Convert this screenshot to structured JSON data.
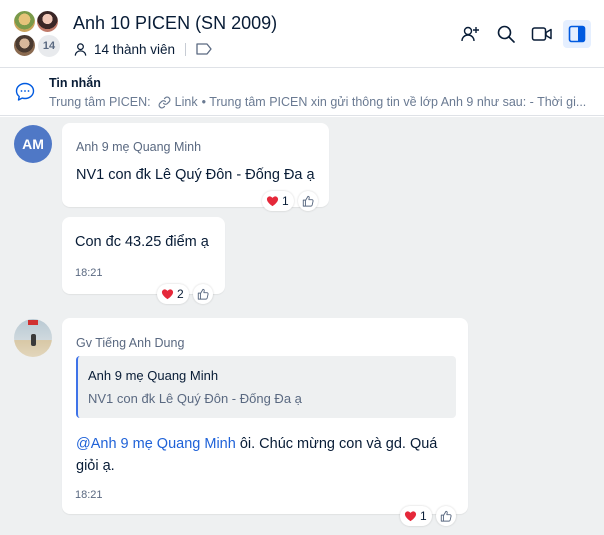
{
  "header": {
    "title": "Anh 10 PICEN (SN 2009)",
    "member_count_badge": "14",
    "members_label": "14 thành viên",
    "icons": [
      "add-member-icon",
      "search-icon",
      "video-call-icon",
      "sidebar-toggle-icon"
    ]
  },
  "pinned": {
    "title": "Tin nhắn",
    "source": "Trung tâm PICEN:",
    "link_label": "Link",
    "preview": "• Trung tâm PICEN xin gửi thông tin về lớp Anh 9 như sau: - Thời gi..."
  },
  "messages": [
    {
      "avatar_initials": "AM",
      "sender": "Anh 9 mẹ Quang Minh",
      "text": "NV1 con đk Lê Quý Đôn - Đống Đa ạ",
      "reaction_count": "1"
    },
    {
      "text": "Con đc 43.25 điểm ạ",
      "time": "18:21",
      "reaction_count": "2"
    },
    {
      "sender": "Gv Tiếng Anh Dung",
      "quote_sender": "Anh 9 mẹ Quang Minh",
      "quote_text": "NV1 con đk Lê Quý Đôn - Đống Đa ạ",
      "mention": "@Anh 9 mẹ Quang Minh",
      "text_line1": " ôi. Chúc mừng con và gd. Quá",
      "text_line2": "giỏi ạ.",
      "time": "18:21",
      "reaction_count": "1"
    }
  ],
  "colors": {
    "accent": "#1f62d8",
    "avatar_am": "#4f78c6",
    "chat_background": "#eef0f1",
    "heart": "#e5283a"
  }
}
